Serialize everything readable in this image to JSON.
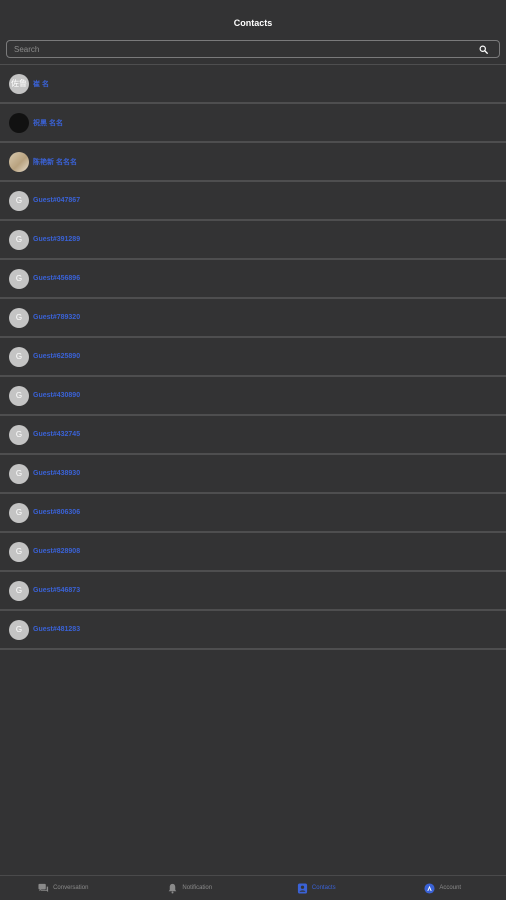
{
  "header": {
    "title": "Contacts"
  },
  "search": {
    "placeholder": "Search"
  },
  "contacts": [
    {
      "name": "崔 名",
      "avatar_text": "佐鲁",
      "avatar_style": "letter"
    },
    {
      "name": "祝黑 名名",
      "avatar_text": "",
      "avatar_style": "dark"
    },
    {
      "name": "陈艳新 名名名",
      "avatar_text": "",
      "avatar_style": "photo"
    },
    {
      "name": "Guest#047867",
      "avatar_text": "G",
      "avatar_style": "letter"
    },
    {
      "name": "Guest#391289",
      "avatar_text": "G",
      "avatar_style": "letter"
    },
    {
      "name": "Guest#456896",
      "avatar_text": "G",
      "avatar_style": "letter"
    },
    {
      "name": "Guest#789320",
      "avatar_text": "G",
      "avatar_style": "letter"
    },
    {
      "name": "Guest#625890",
      "avatar_text": "G",
      "avatar_style": "letter"
    },
    {
      "name": "Guest#430890",
      "avatar_text": "G",
      "avatar_style": "letter"
    },
    {
      "name": "Guest#432745",
      "avatar_text": "G",
      "avatar_style": "letter"
    },
    {
      "name": "Guest#438930",
      "avatar_text": "G",
      "avatar_style": "letter"
    },
    {
      "name": "Guest#806306",
      "avatar_text": "G",
      "avatar_style": "letter"
    },
    {
      "name": "Guest#828908",
      "avatar_text": "G",
      "avatar_style": "letter"
    },
    {
      "name": "Guest#546873",
      "avatar_text": "G",
      "avatar_style": "letter"
    },
    {
      "name": "Guest#481283",
      "avatar_text": "G",
      "avatar_style": "letter"
    }
  ],
  "tabbar": {
    "tabs": [
      {
        "label": "Conversation",
        "icon": "chat-icon",
        "active": false
      },
      {
        "label": "Notification",
        "icon": "bell-icon",
        "active": false
      },
      {
        "label": "Contacts",
        "icon": "contacts-icon",
        "active": true
      },
      {
        "label": "Account",
        "icon": "account-icon",
        "active": false
      }
    ]
  },
  "colors": {
    "background": "#333334",
    "accent": "#3a62d6",
    "divider": "#4e4e4f",
    "avatar_gray": "#c4c4c4"
  }
}
